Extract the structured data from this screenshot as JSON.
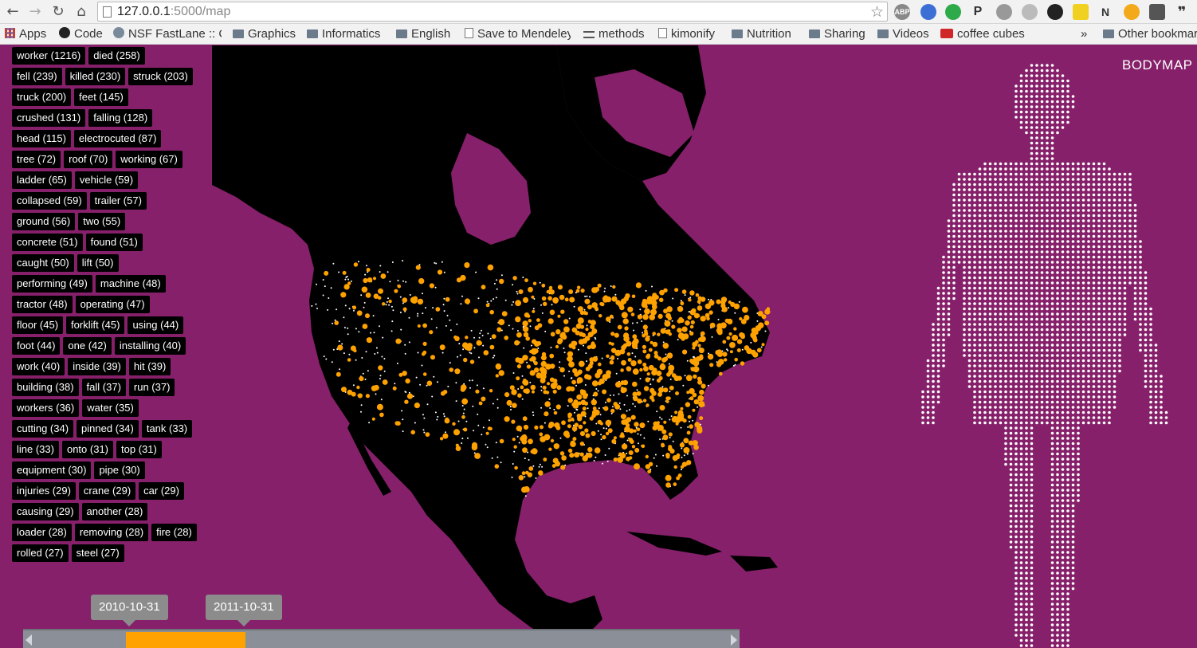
{
  "browser": {
    "url_host": "127.0.0.1",
    "url_path": ":5000/map",
    "bookmarks": [
      {
        "label": "Apps",
        "icon": "apps-grid-icon"
      },
      {
        "label": "Code",
        "icon": "github-icon"
      },
      {
        "label": "NSF FastLane :: C",
        "icon": "nsf-icon"
      },
      {
        "label": "Graphics",
        "icon": "folder-icon"
      },
      {
        "label": "Informatics",
        "icon": "folder-icon"
      },
      {
        "label": "English",
        "icon": "folder-icon"
      },
      {
        "label": "Save to Mendeley",
        "icon": "page-icon"
      },
      {
        "label": "methods",
        "icon": "methods-icon"
      },
      {
        "label": "kimonify",
        "icon": "page-icon"
      },
      {
        "label": "Nutrition",
        "icon": "folder-icon"
      },
      {
        "label": "Sharing",
        "icon": "folder-icon"
      },
      {
        "label": "Videos",
        "icon": "folder-icon"
      },
      {
        "label": "coffee cubes",
        "icon": "go-icon"
      }
    ],
    "overflow_label": "»",
    "other_bookmarks": "Other bookmarks",
    "extensions": [
      "ABP",
      "shield",
      "hangouts",
      "P",
      "audio",
      "cast",
      "dark",
      "note",
      "N",
      "star",
      "lamp",
      "quote"
    ]
  },
  "app": {
    "brand": "BODYMAP",
    "tag_rows": [
      [
        "worker (1216)",
        "died (258)"
      ],
      [
        "fell (239)",
        "killed (230)",
        "struck (203)"
      ],
      [
        "truck (200)",
        "feet (145)"
      ],
      [
        "crushed (131)",
        "falling (128)"
      ],
      [
        "head (115)",
        "electrocuted (87)"
      ],
      [
        "tree (72)",
        "roof (70)",
        "working (67)"
      ],
      [
        "ladder (65)",
        "vehicle (59)"
      ],
      [
        "collapsed (59)",
        "trailer (57)"
      ],
      [
        "ground (56)",
        "two (55)"
      ],
      [
        "concrete (51)",
        "found (51)"
      ],
      [
        "caught (50)",
        "lift (50)"
      ],
      [
        "performing (49)",
        "machine (48)"
      ],
      [
        "tractor (48)",
        "operating (47)"
      ],
      [
        "floor (45)",
        "forklift (45)",
        "using (44)"
      ],
      [
        "foot (44)",
        "one (42)",
        "installing (40)"
      ],
      [
        "work (40)",
        "inside (39)",
        "hit (39)"
      ],
      [
        "building (38)",
        "fall (37)",
        "run (37)"
      ],
      [
        "workers (36)",
        "water (35)"
      ],
      [
        "cutting (34)",
        "pinned (34)",
        "tank (33)"
      ],
      [
        "line (33)",
        "onto (31)",
        "top (31)"
      ],
      [
        "equipment (30)",
        "pipe (30)"
      ],
      [
        "injuries (29)",
        "crane (29)",
        "car (29)"
      ],
      [
        "causing (29)",
        "another (28)"
      ],
      [
        "loader (28)",
        "removing (28)",
        "fire (28)"
      ],
      [
        "rolled (27)",
        "steel (27)"
      ]
    ],
    "slider": {
      "start": "2010-10-31",
      "end": "2011-10-31",
      "range_fraction": [
        0.143,
        0.31
      ]
    },
    "colors": {
      "background": "#86206a",
      "land": "#000000",
      "incident": "#ffa200",
      "dot": "#ffffff"
    }
  }
}
